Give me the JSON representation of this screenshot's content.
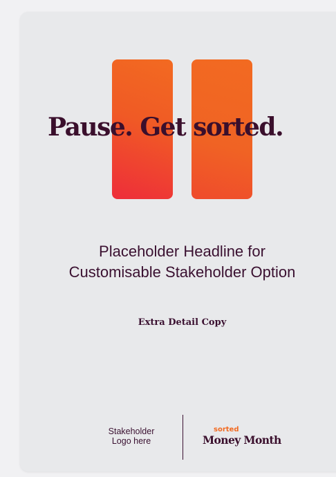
{
  "hero": {
    "title": "Pause. Get sorted."
  },
  "headline": {
    "line1": "Placeholder Headline for",
    "line2": "Customisable Stakeholder Option"
  },
  "detail": "Extra Detail Copy",
  "footer": {
    "stakeholder_line1": "Stakeholder",
    "stakeholder_line2": "Logo here",
    "brand_small": "sorted",
    "brand_main": "Money Month"
  },
  "colors": {
    "background": "#f1f1f3",
    "card": "#e8e9eb",
    "text_dark": "#3a0f2c",
    "accent_orange": "#f26a21",
    "accent_red": "#ee2d3a"
  },
  "icons": {
    "pause_graphic": "pause-icon"
  }
}
